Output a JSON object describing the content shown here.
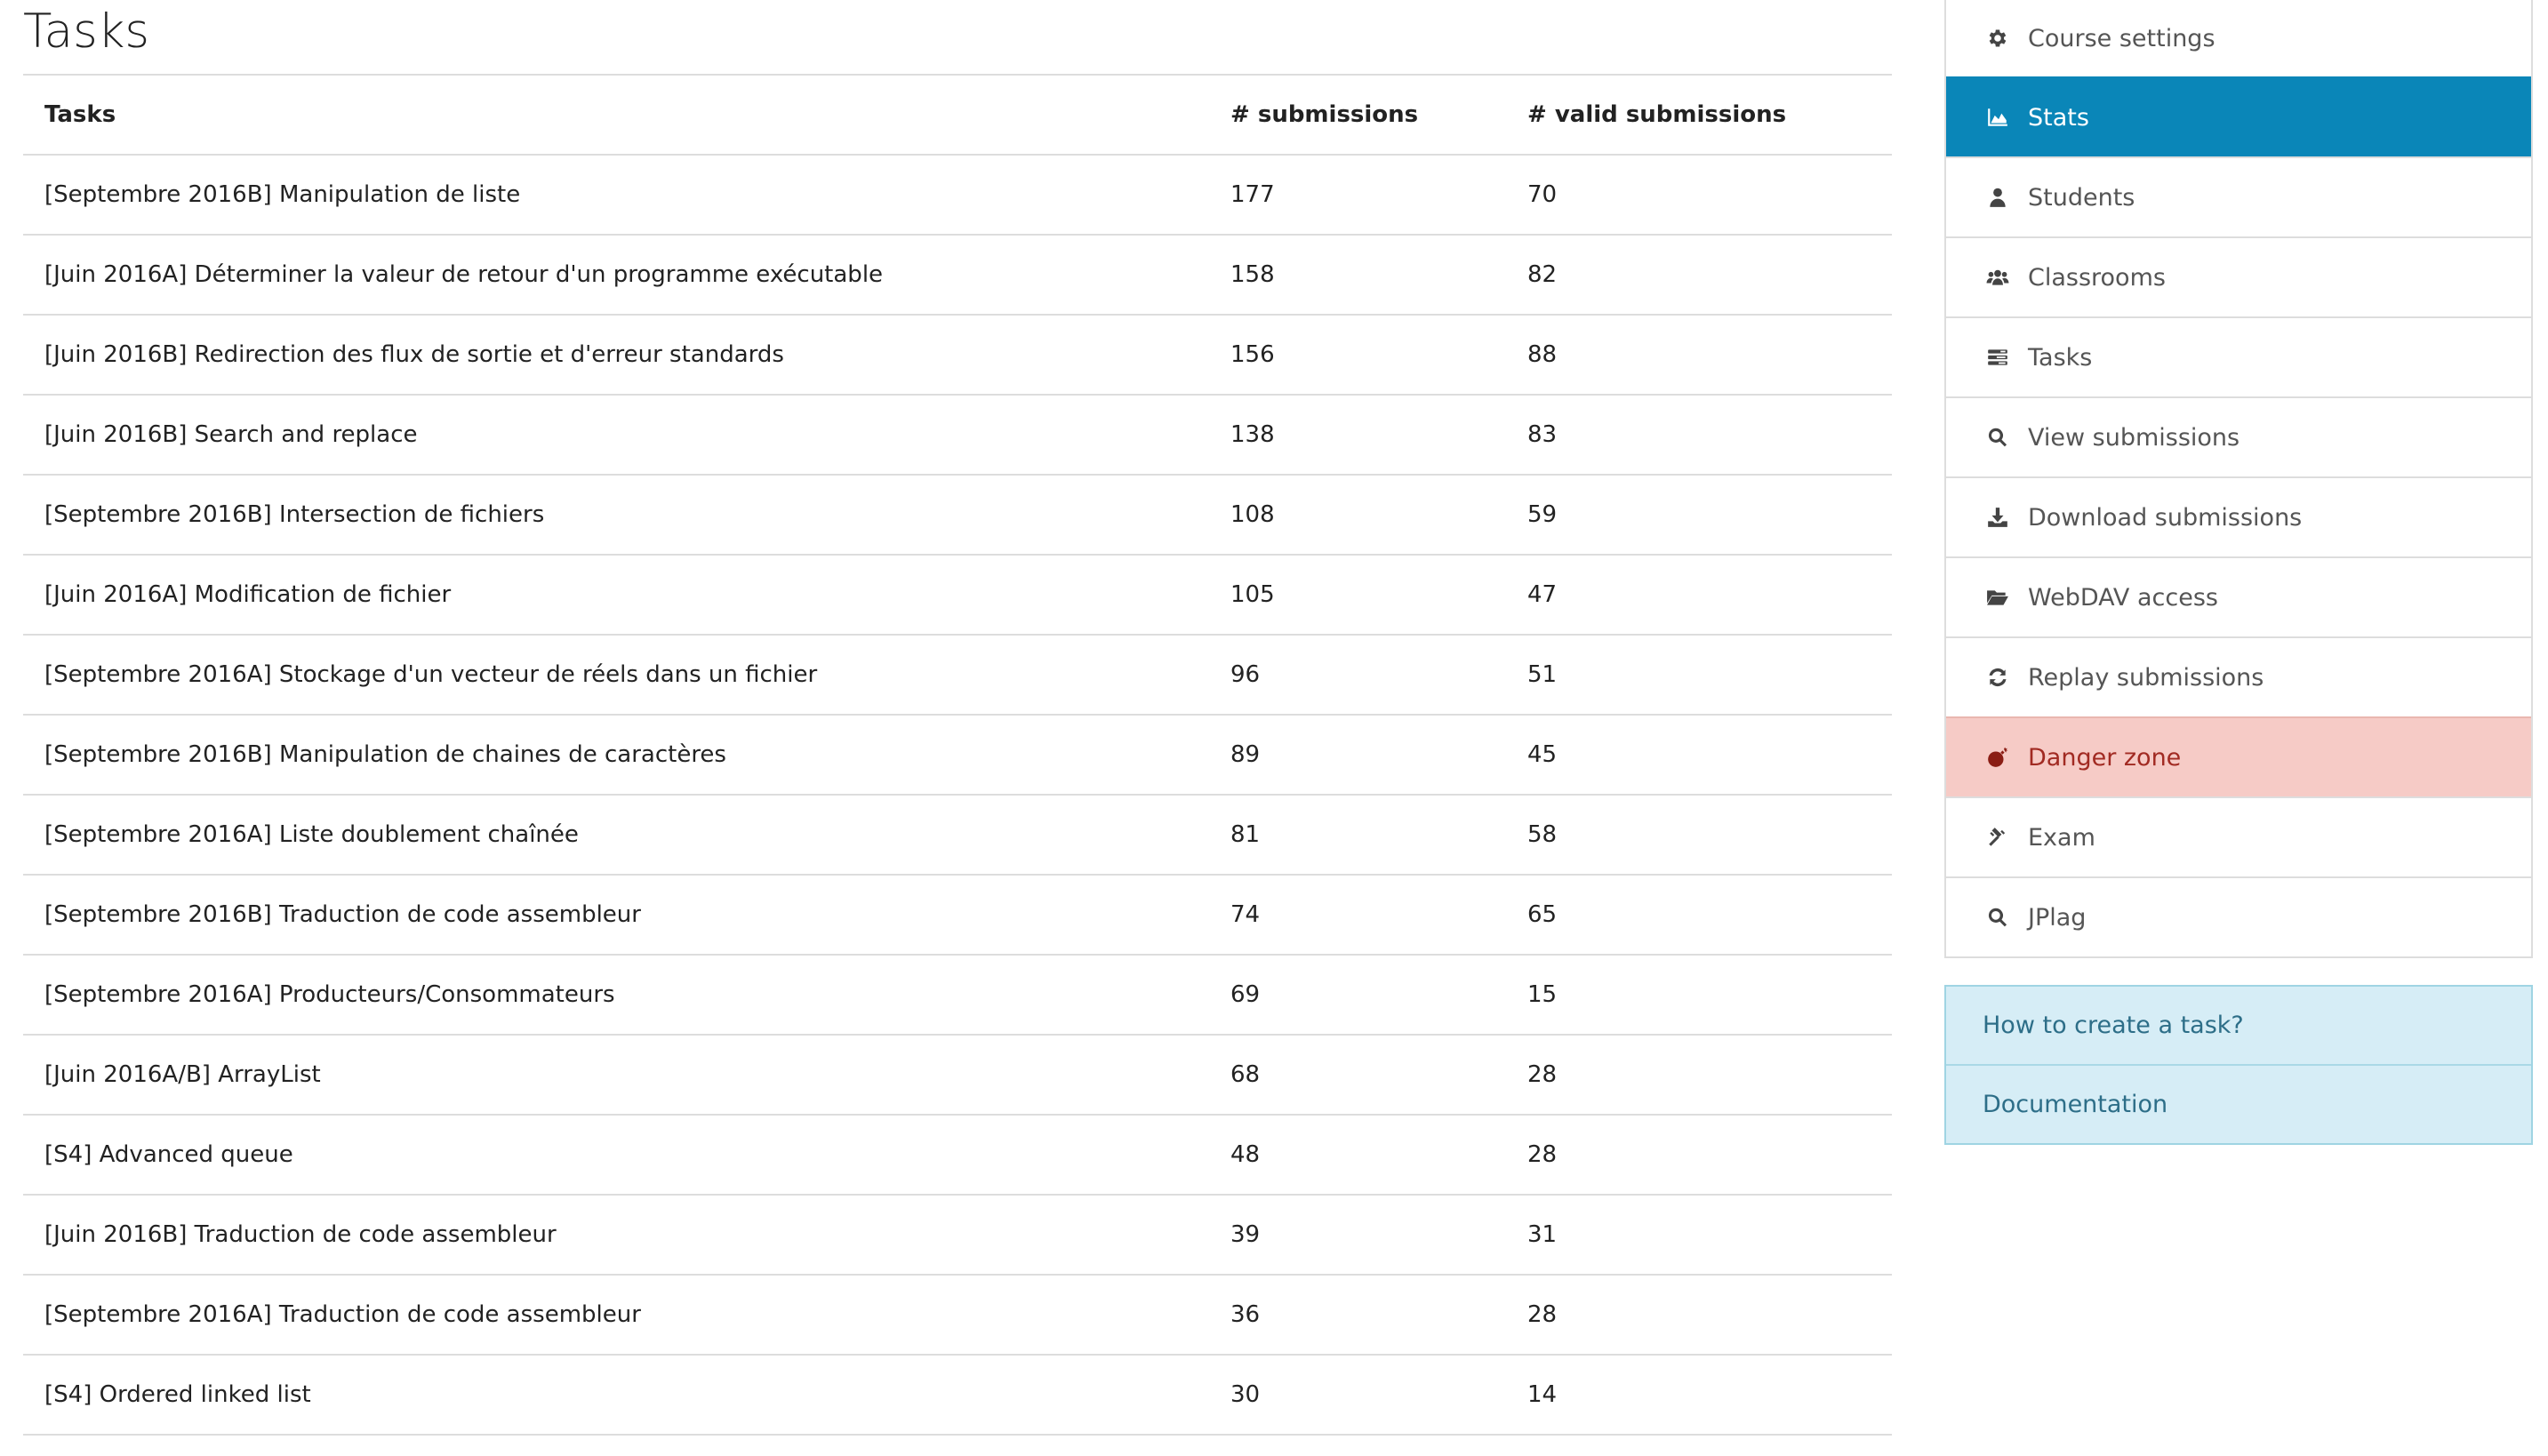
{
  "page": {
    "title": "Tasks"
  },
  "table": {
    "headers": [
      "Tasks",
      "# submissions",
      "# valid submissions"
    ],
    "rows": [
      {
        "name": "[Septembre 2016B] Manipulation de liste",
        "submissions": "177",
        "valid": "70"
      },
      {
        "name": "[Juin 2016A] Déterminer la valeur de retour d'un programme exécutable",
        "submissions": "158",
        "valid": "82"
      },
      {
        "name": "[Juin 2016B] Redirection des flux de sortie et d'erreur standards",
        "submissions": "156",
        "valid": "88"
      },
      {
        "name": "[Juin 2016B] Search and replace",
        "submissions": "138",
        "valid": "83"
      },
      {
        "name": "[Septembre 2016B] Intersection de fichiers",
        "submissions": "108",
        "valid": "59"
      },
      {
        "name": "[Juin 2016A] Modification de fichier",
        "submissions": "105",
        "valid": "47"
      },
      {
        "name": "[Septembre 2016A] Stockage d'un vecteur de réels dans un fichier",
        "submissions": "96",
        "valid": "51"
      },
      {
        "name": "[Septembre 2016B] Manipulation de chaines de caractères",
        "submissions": "89",
        "valid": "45"
      },
      {
        "name": "[Septembre 2016A] Liste doublement chaînée",
        "submissions": "81",
        "valid": "58"
      },
      {
        "name": "[Septembre 2016B] Traduction de code assembleur",
        "submissions": "74",
        "valid": "65"
      },
      {
        "name": "[Septembre 2016A] Producteurs/Consommateurs",
        "submissions": "69",
        "valid": "15"
      },
      {
        "name": "[Juin 2016A/B] ArrayList",
        "submissions": "68",
        "valid": "28"
      },
      {
        "name": "[S4] Advanced queue",
        "submissions": "48",
        "valid": "28"
      },
      {
        "name": "[Juin 2016B] Traduction de code assembleur",
        "submissions": "39",
        "valid": "31"
      },
      {
        "name": "[Septembre 2016A] Traduction de code assembleur",
        "submissions": "36",
        "valid": "28"
      },
      {
        "name": "[S4] Ordered linked list",
        "submissions": "30",
        "valid": "14"
      }
    ]
  },
  "sidebar": {
    "menu": [
      {
        "id": "course-settings",
        "label": "Course settings",
        "icon": "gear-icon",
        "state": "normal"
      },
      {
        "id": "stats",
        "label": "Stats",
        "icon": "area-chart-icon",
        "state": "active"
      },
      {
        "id": "students",
        "label": "Students",
        "icon": "user-icon",
        "state": "normal"
      },
      {
        "id": "classrooms",
        "label": "Classrooms",
        "icon": "users-icon",
        "state": "normal"
      },
      {
        "id": "tasks",
        "label": "Tasks",
        "icon": "tasks-icon",
        "state": "normal"
      },
      {
        "id": "view-submissions",
        "label": "View submissions",
        "icon": "search-icon",
        "state": "normal"
      },
      {
        "id": "download-submissions",
        "label": "Download submissions",
        "icon": "download-icon",
        "state": "normal"
      },
      {
        "id": "webdav-access",
        "label": "WebDAV access",
        "icon": "folder-open-icon",
        "state": "normal"
      },
      {
        "id": "replay-submissions",
        "label": "Replay submissions",
        "icon": "refresh-icon",
        "state": "normal"
      },
      {
        "id": "danger-zone",
        "label": "Danger zone",
        "icon": "bomb-icon",
        "state": "danger"
      },
      {
        "id": "exam",
        "label": "Exam",
        "icon": "gavel-icon",
        "state": "normal"
      },
      {
        "id": "jplag",
        "label": "JPlag",
        "icon": "search-icon",
        "state": "normal"
      }
    ],
    "help": [
      {
        "id": "how-to-create-task",
        "label": "How to create a task?"
      },
      {
        "id": "documentation",
        "label": "Documentation"
      }
    ]
  },
  "colors": {
    "active_bg": "#0a86b8",
    "danger_bg": "#f6cbc6",
    "help_bg": "#d6edf6"
  }
}
